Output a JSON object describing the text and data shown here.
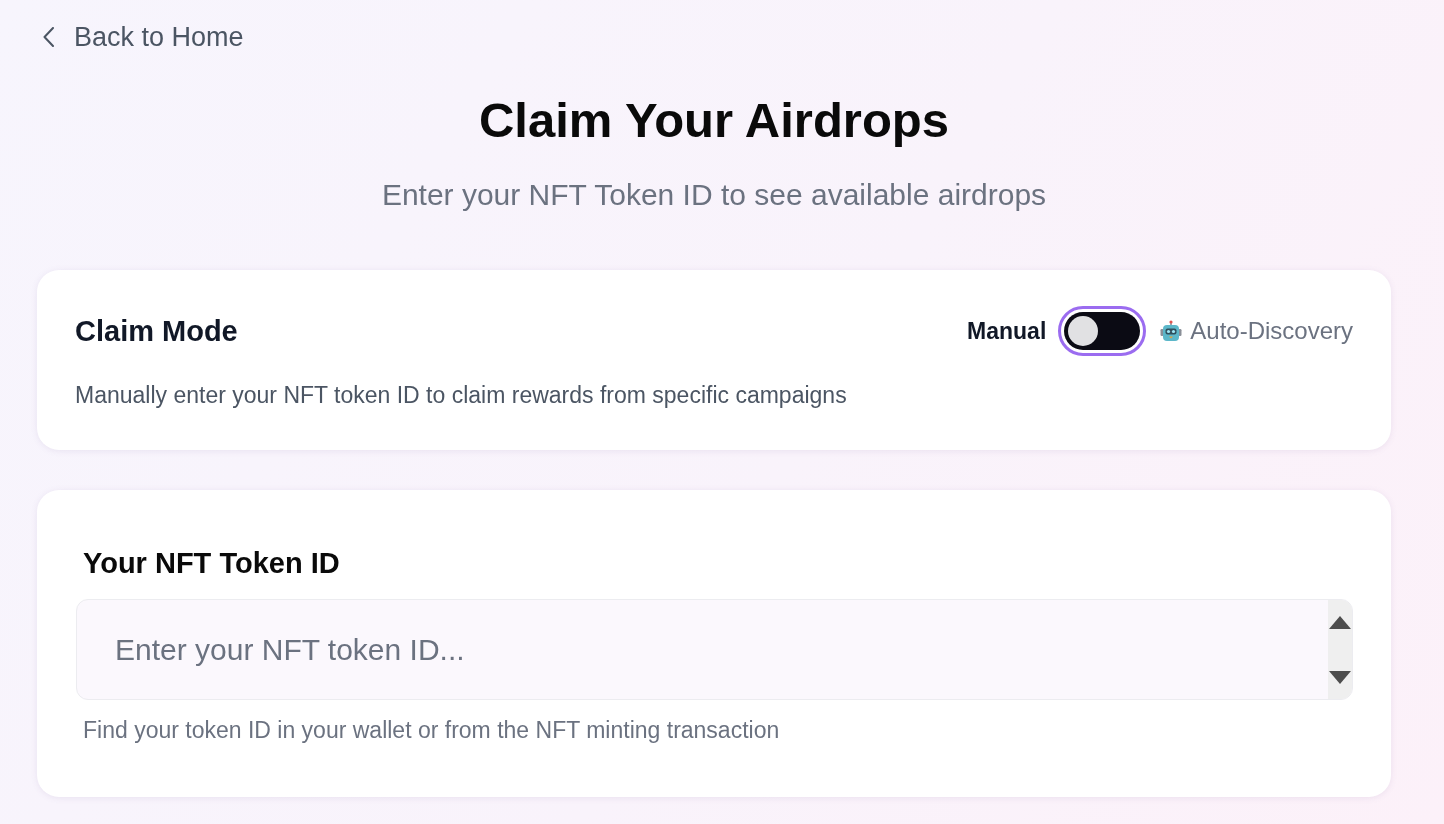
{
  "back_link": {
    "label": "Back to Home"
  },
  "header": {
    "title": "Claim Your Airdrops",
    "subtitle": "Enter your NFT Token ID to see available airdrops"
  },
  "claim_mode": {
    "title": "Claim Mode",
    "left_label": "Manual",
    "toggle": {
      "on": false,
      "focused": true
    },
    "right_label": "Auto-Discovery",
    "description": "Manually enter your NFT token ID to claim rewards from specific campaigns"
  },
  "token_form": {
    "label": "Your NFT Token ID",
    "input": {
      "placeholder": "Enter your NFT token ID..."
    },
    "hint": "Find your token ID in your wallet or from the NFT minting transaction"
  }
}
